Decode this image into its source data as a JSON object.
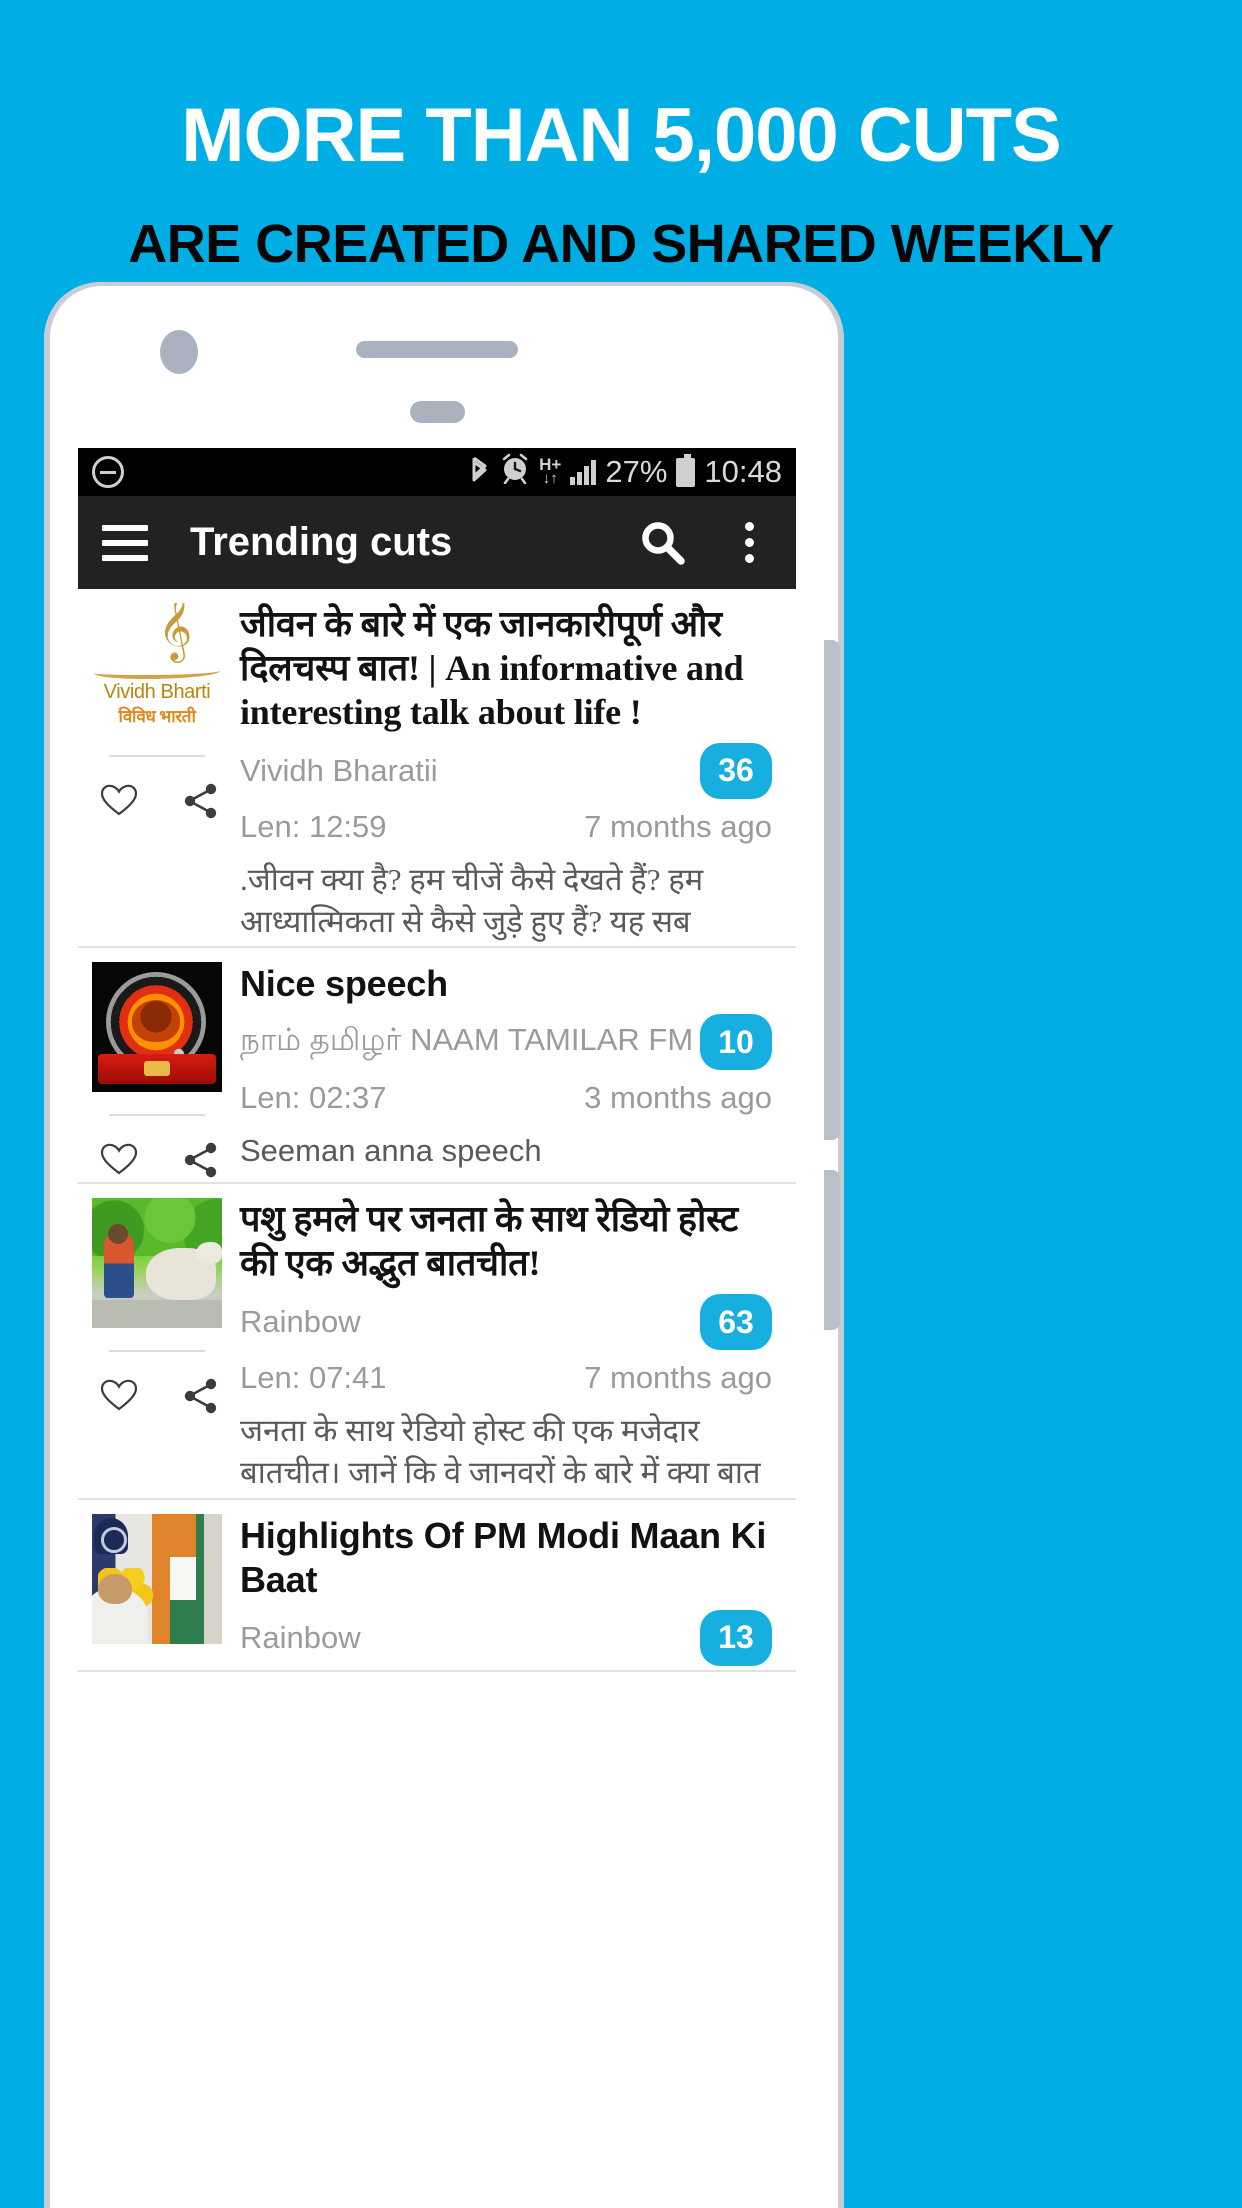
{
  "promo": {
    "line1": "MORE THAN 5,000 CUTS",
    "line2": "ARE CREATED AND SHARED WEEKLY",
    "bg_color": "#00AEE6",
    "line1_color": "#FFFFFF",
    "line2_color": "#050505"
  },
  "statusbar": {
    "left_icon": "minus-circle-icon",
    "icons": [
      "bluetooth-icon",
      "alarm-icon",
      "hplus-data-icon",
      "signal-bars-icon"
    ],
    "hplus_label": "H+",
    "battery_percent": "27%",
    "time": "10:48",
    "battery_icon": "battery-icon",
    "bg_color": "#000000"
  },
  "appbar": {
    "menu_icon": "hamburger-menu-icon",
    "title": "Trending cuts",
    "search_icon": "search-icon",
    "overflow_icon": "overflow-menu-icon",
    "bg_color": "#222222"
  },
  "badge_color": "#17AEE0",
  "cards": [
    {
      "thumb": "vividh-bharati-logo",
      "thumb_text_en": "Vividh Bharti",
      "thumb_text_hi": "विविध भारती",
      "title": "जीवन के बारे में एक जानकारीपूर्ण और दिलचस्प बात! | An informative and interesting talk about life !",
      "channel": "Vividh Bharatii",
      "badge": "36",
      "length": "Len: 12:59",
      "age": "7 months ago",
      "description": ".जीवन क्या है? हम चीजें कैसे देखते हैं? हम आध्यात्मिकता से कैसे जुड़े हुए हैं? यह सब",
      "like_icon": "heart-icon",
      "share_icon": "share-icon"
    },
    {
      "thumb": "naam-tamilar-fm-logo",
      "title": "Nice speech",
      "channel": "நாம் தமிழர் NAAM TAMILAR FM",
      "badge": "10",
      "length": "Len: 02:37",
      "age": "3 months ago",
      "description": "Seeman anna speech",
      "like_icon": "heart-icon",
      "share_icon": "share-icon"
    },
    {
      "thumb": "dog-attack-photo",
      "title": "पशु हमले पर जनता के साथ रेडियो होस्ट की एक अद्भुत बातचीत!",
      "channel": "Rainbow",
      "badge": "63",
      "length": "Len: 07:41",
      "age": "7 months ago",
      "description": "जनता के साथ रेडियो होस्ट की एक मजेदार बातचीत। जानें कि वे जानवरों के बारे में क्या बात",
      "like_icon": "heart-icon",
      "share_icon": "share-icon"
    },
    {
      "thumb": "pm-modi-photo",
      "title": "Highlights Of PM Modi Maan Ki Baat",
      "channel": "Rainbow",
      "badge": "13",
      "length": "",
      "age": "",
      "description": "",
      "like_icon": "heart-icon",
      "share_icon": "share-icon"
    }
  ]
}
